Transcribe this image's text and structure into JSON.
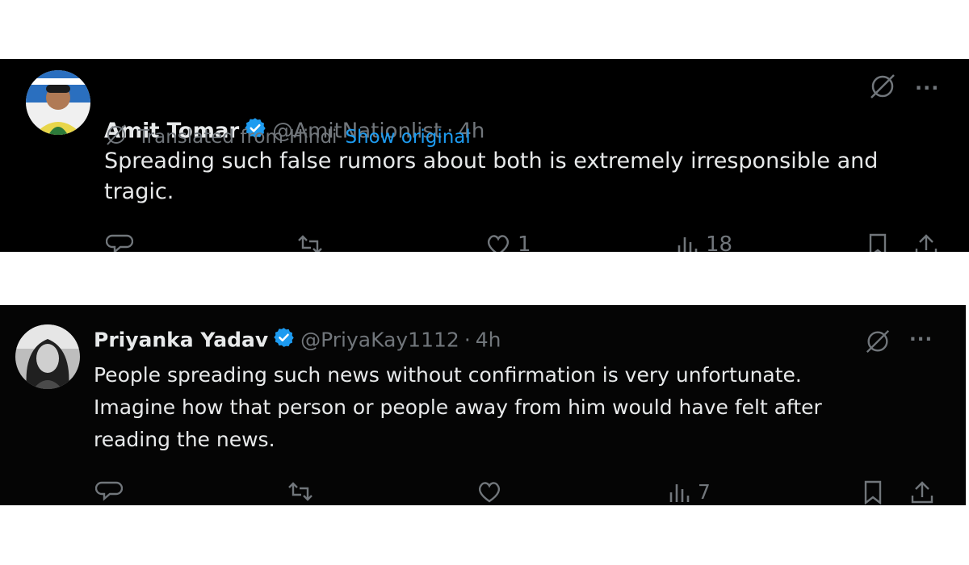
{
  "tweets": [
    {
      "author": "Amit Tomar",
      "handle": "@AmitNationlist",
      "separator": "·",
      "time": "4h",
      "translation_note": "Translated from Hindi",
      "show_original": "Show original",
      "text": "Spreading such false rumors about both is extremely irresponsible and tragic.",
      "actions": {
        "replies": "",
        "reposts": "",
        "likes": "1",
        "views": "18"
      },
      "icons": [
        "grok-icon",
        "more-icon",
        "reply-icon",
        "repost-icon",
        "like-icon",
        "views-icon",
        "bookmark-icon",
        "share-icon"
      ]
    },
    {
      "author": "Priyanka Yadav",
      "handle": "@PriyaKay1112",
      "separator": "·",
      "time": "4h",
      "text": "People spreading such news without confirmation is very unfortunate.\nImagine how that person or people away from him would have felt after\nreading the news.",
      "actions": {
        "replies": "",
        "reposts": "",
        "likes": "",
        "views": "7"
      },
      "icons": [
        "grok-icon",
        "more-icon",
        "reply-icon",
        "repost-icon",
        "like-icon",
        "views-icon",
        "bookmark-icon",
        "share-icon"
      ]
    }
  ],
  "colors": {
    "background": "#000000",
    "text": "#e7e9ea",
    "muted": "#71767b",
    "link": "#1d9bf0",
    "verified": "#1d9bf0"
  }
}
